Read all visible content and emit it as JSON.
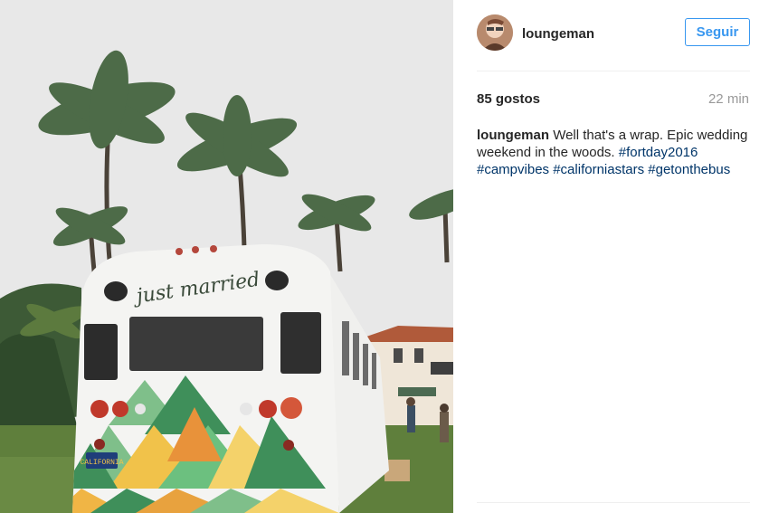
{
  "post": {
    "image": {
      "painted_text": "just married",
      "plate_text": "CALIFORNIA",
      "sky_color": "#e8e8e8",
      "bus_color": "#f4f4f2"
    },
    "author": {
      "username": "loungeman",
      "follow_label": "Seguir"
    },
    "stats": {
      "likes": "85 gostos",
      "time": "22 min"
    },
    "caption": {
      "username": "loungeman",
      "text": "Well that's a wrap. Epic wedding weekend in the woods.",
      "hashtags": [
        "#fortday2016",
        "#campvibes",
        "#californiastars",
        "#getonthebus"
      ]
    },
    "colors": {
      "accent": "#3897f0",
      "hashtag": "#003569",
      "text": "#262626",
      "muted": "#999999"
    }
  }
}
